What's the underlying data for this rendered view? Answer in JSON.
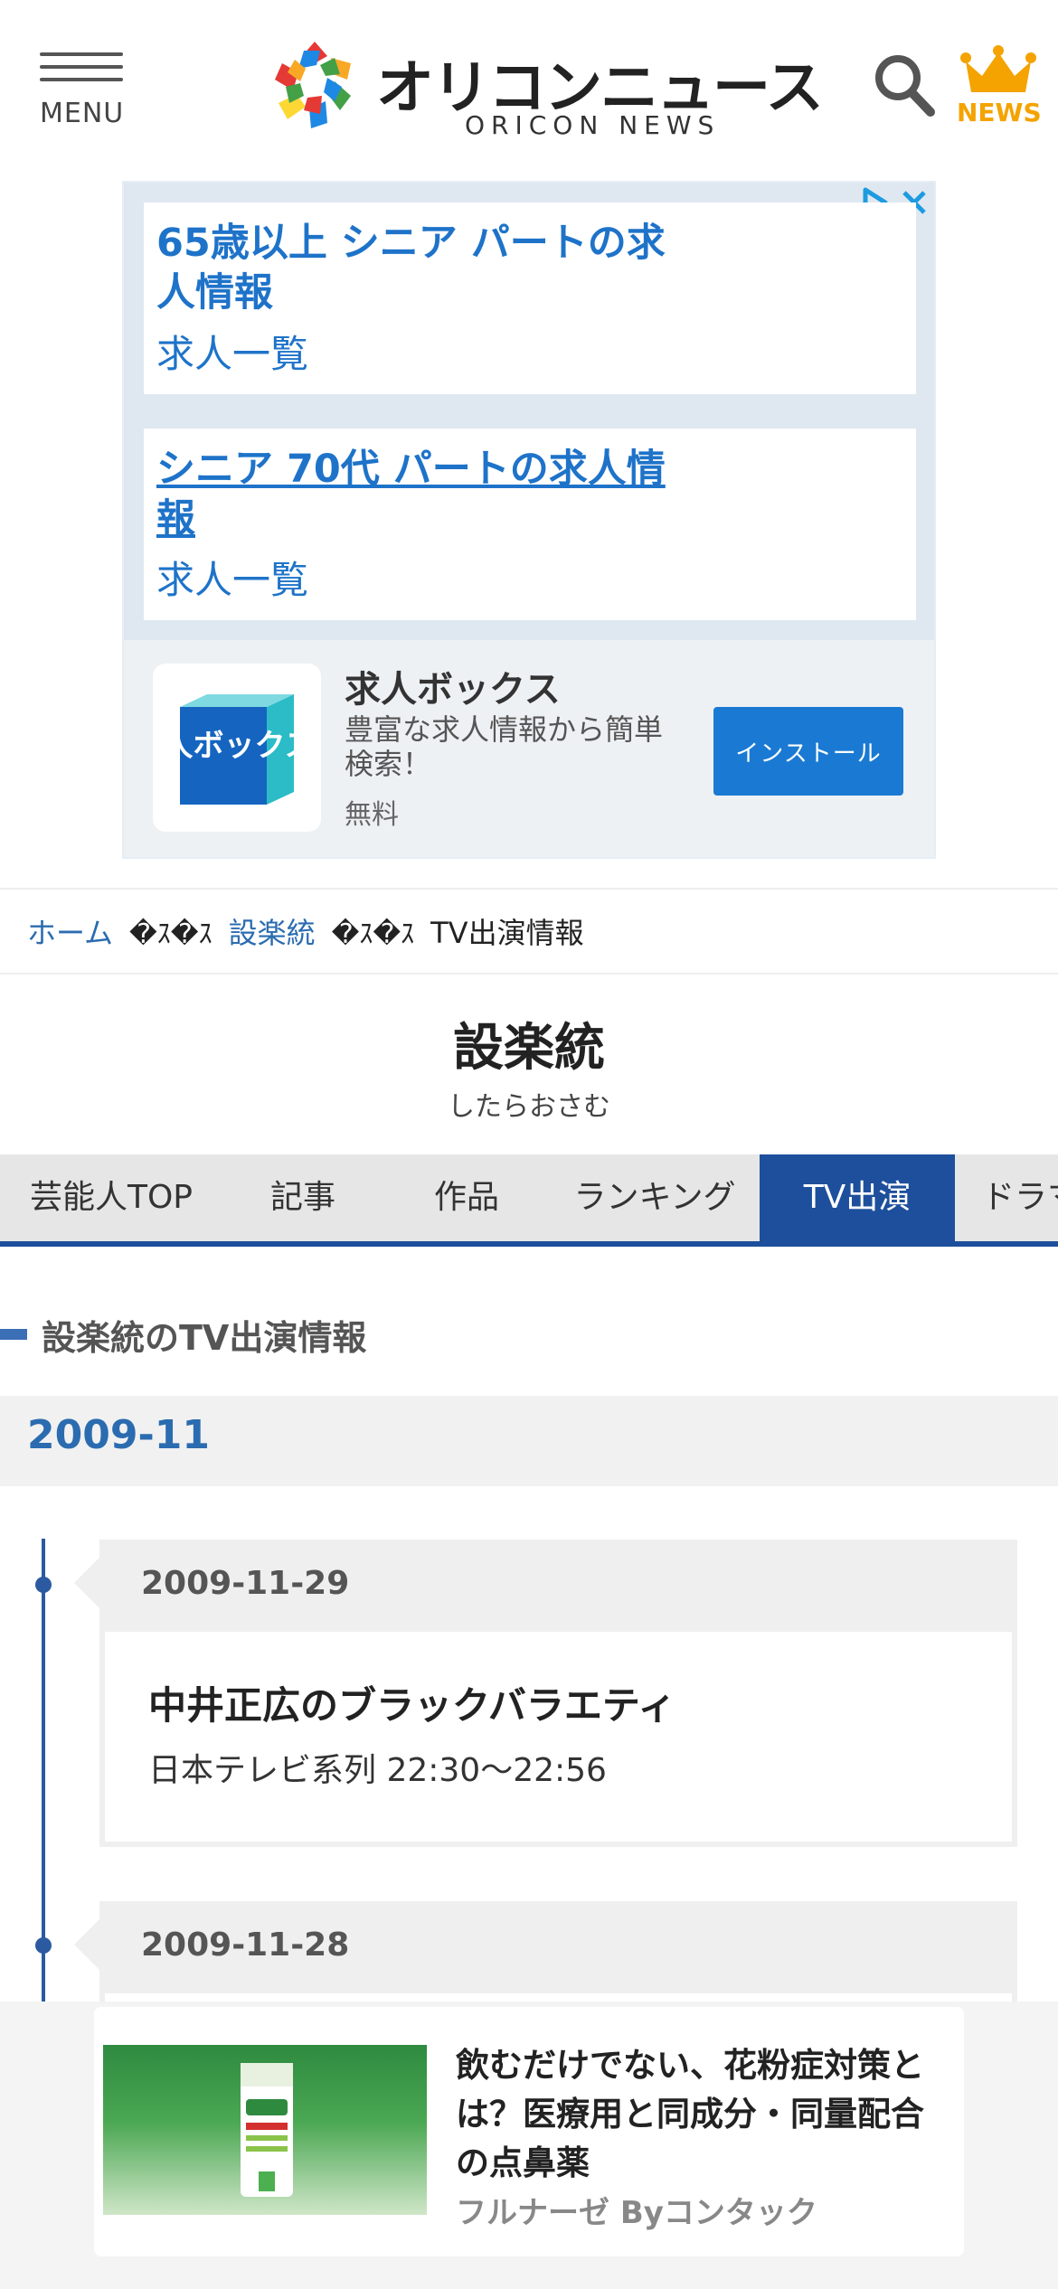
{
  "header": {
    "menu_label": "MENU",
    "logo_jp": "オリコンニュース",
    "logo_en": "ORICON NEWS",
    "news_label": "NEWS"
  },
  "ad": {
    "cards": [
      {
        "title": "65歳以上 シニア パートの求人情報",
        "link": "求人一覧"
      },
      {
        "title": "シニア 70代 パートの求人情報",
        "link": "求人一覧"
      }
    ],
    "app": {
      "icon_text": "求人ボックス",
      "name": "求人ボックス",
      "description": "豊富な求人情報から簡単検索！",
      "price": "無料",
      "install_label": "インストール"
    }
  },
  "breadcrumb": {
    "home": "ホーム",
    "separator": "�ｽ�ｽ",
    "artist": "設楽統",
    "current": "TV出演情報"
  },
  "artist": {
    "name": "設楽統",
    "kana": "したらおさむ"
  },
  "tabs": [
    {
      "label": "芸能人TOP"
    },
    {
      "label": "記事"
    },
    {
      "label": "作品"
    },
    {
      "label": "ランキング"
    },
    {
      "label": "TV出演"
    },
    {
      "label": "ドラマ"
    }
  ],
  "section_title": "設楽統のTV出演情報",
  "month": "2009-11",
  "entries": [
    {
      "date": "2009-11-29",
      "program": "中井正広のブラックバラエティ",
      "channel": "日本テレビ系列 22:30〜22:56"
    },
    {
      "date": "2009-11-28"
    }
  ],
  "bottom_ad": {
    "text": "飲むだけでない、花粉症対策とは？医療用と同成分・同量配合の点鼻薬",
    "sponsor": "フルナーゼ Byコンタック"
  },
  "colors": {
    "brand_blue": "#1d4f9c",
    "link_blue": "#2b6cb0",
    "ad_blue": "#1e73c9",
    "news_gold": "#f4a300"
  }
}
